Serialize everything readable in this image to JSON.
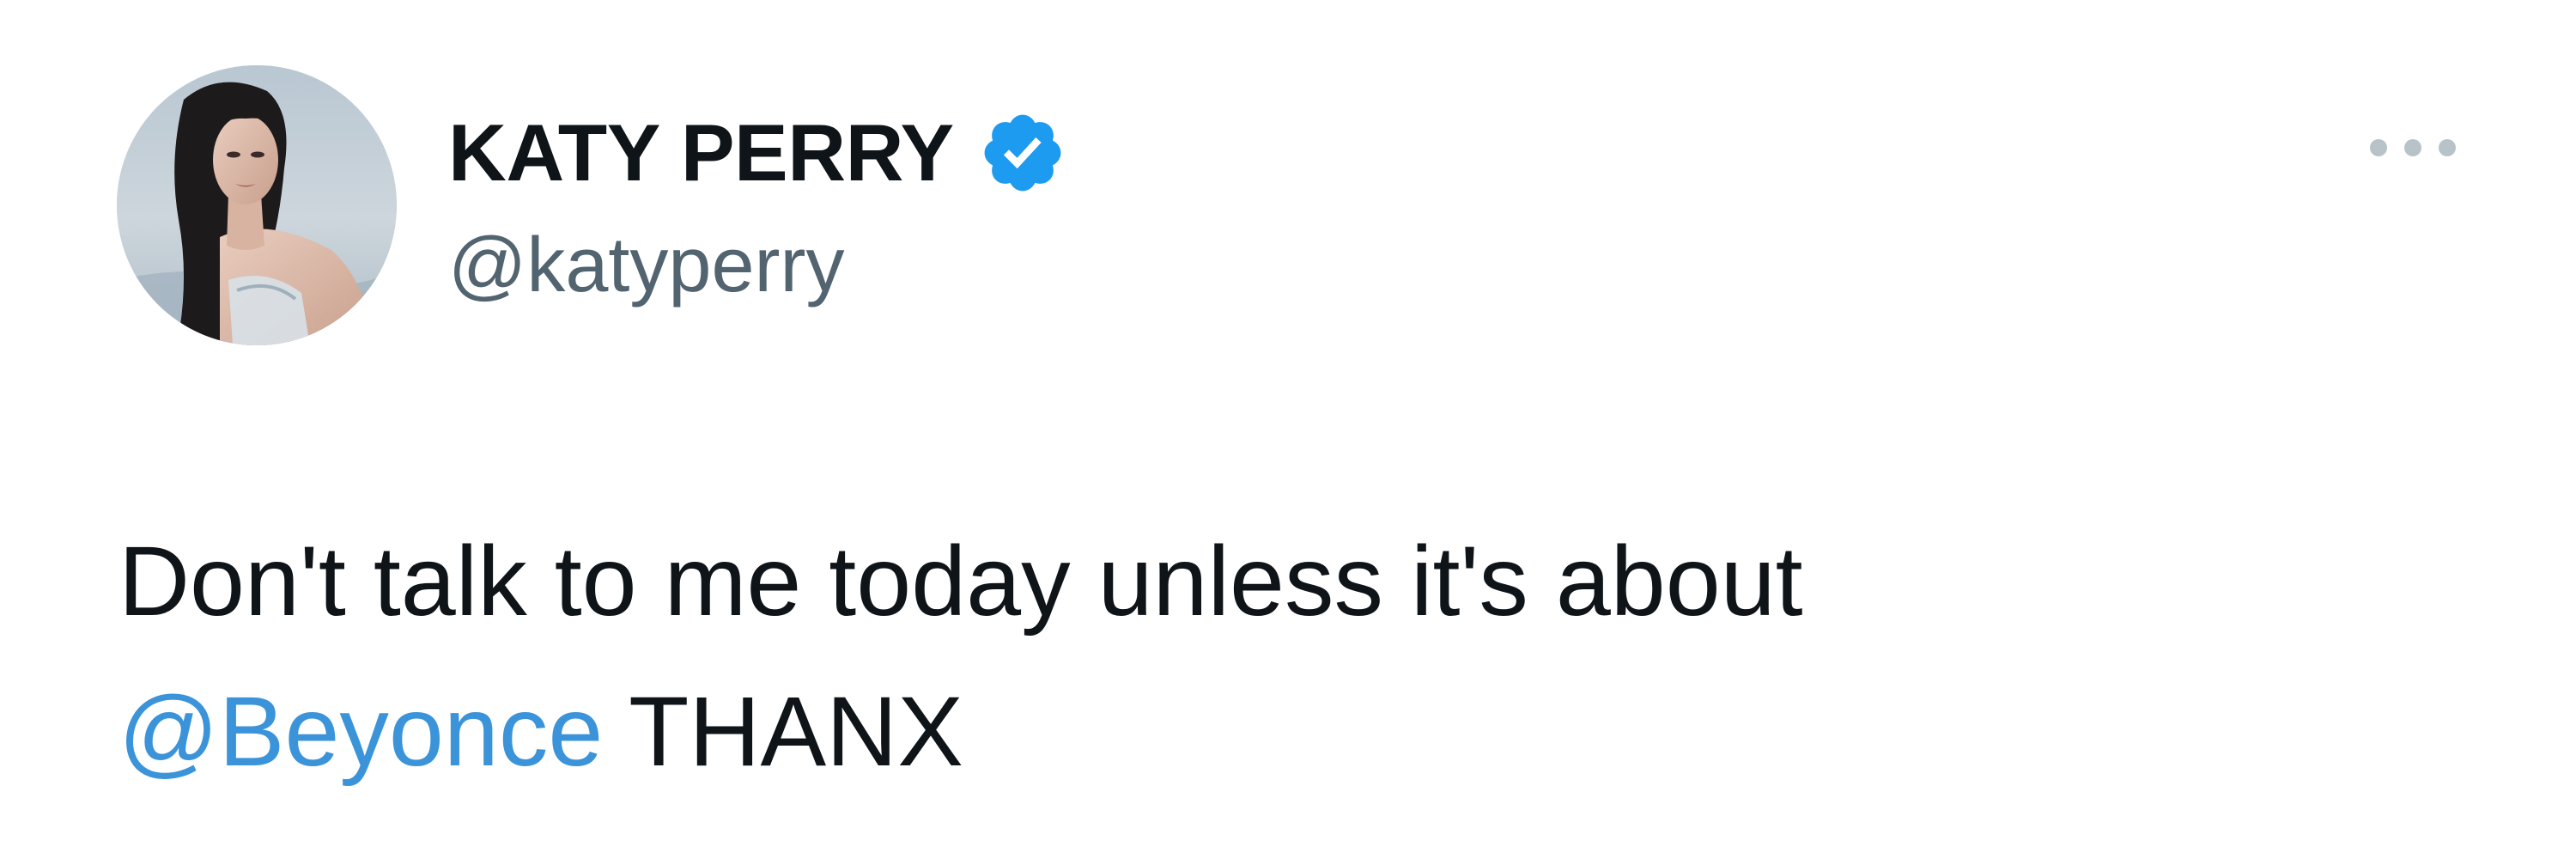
{
  "tweet": {
    "author": {
      "display_name": "KATY PERRY",
      "handle": "@katyperry",
      "verified": true,
      "verified_icon": "verified-badge-icon"
    },
    "more_icon": "more-options-icon",
    "text": {
      "line1": "Don't talk to me today unless it's about",
      "mention": "@Beyonce",
      "line2_rest": " THANX"
    }
  },
  "colors": {
    "text_primary": "#0f1419",
    "text_secondary": "#536471",
    "link": "#3b94d9",
    "verified": "#1d9bf0",
    "background": "#ffffff"
  }
}
